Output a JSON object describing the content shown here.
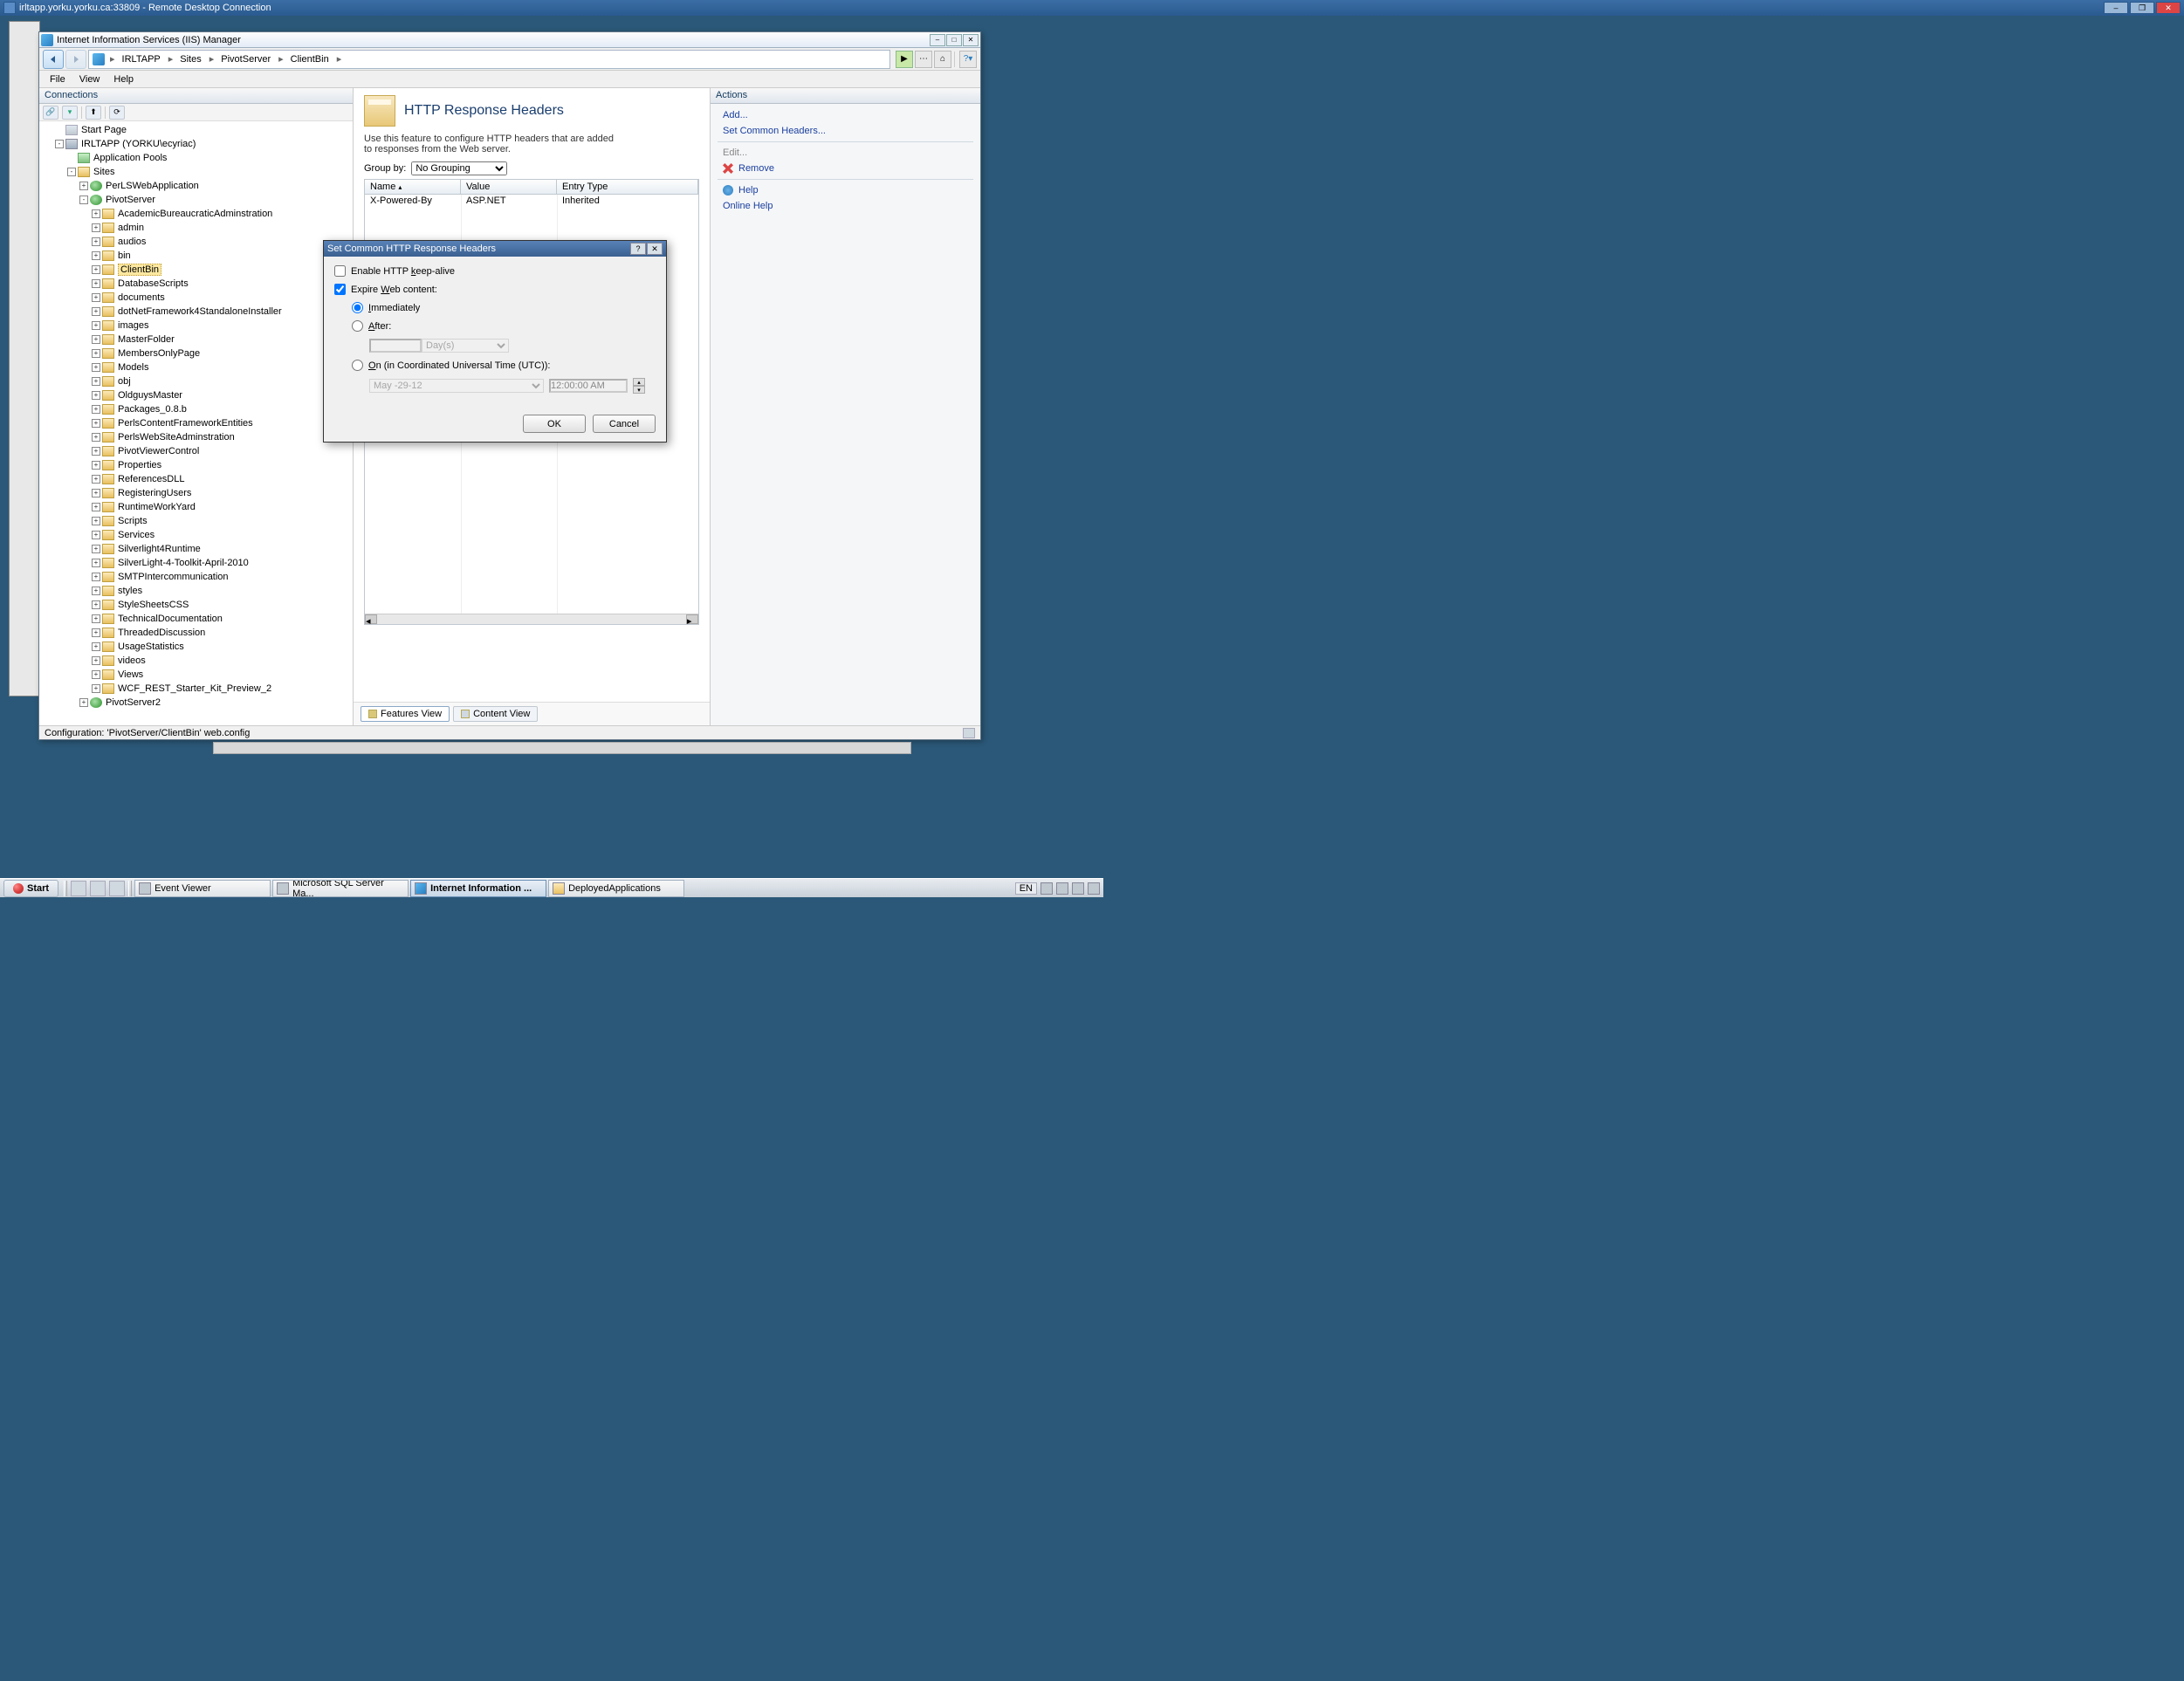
{
  "rdp": {
    "title": "irltapp.yorku.yorku.ca:33809 - Remote Desktop Connection"
  },
  "iis": {
    "title": "Internet Information Services (IIS) Manager",
    "breadcrumb": [
      "IRLTAPP",
      "Sites",
      "PivotServer",
      "ClientBin"
    ],
    "menu": [
      "File",
      "View",
      "Help"
    ],
    "connections_header": "Connections",
    "actions_header": "Actions",
    "status": "Configuration: 'PivotServer/ClientBin' web.config",
    "feature": {
      "title": "HTTP Response Headers",
      "desc": "Use this feature to configure HTTP headers that are added to responses from the Web server.",
      "groupby_label": "Group by:",
      "groupby_value": "No Grouping",
      "columns": [
        "Name",
        "Value",
        "Entry Type"
      ],
      "rows": [
        {
          "name": "X-Powered-By",
          "value": "ASP.NET",
          "entry": "Inherited"
        }
      ],
      "view_tabs": {
        "features": "Features View",
        "content": "Content View"
      }
    },
    "actions": {
      "add": "Add...",
      "set_common": "Set Common Headers...",
      "edit": "Edit...",
      "remove": "Remove",
      "help": "Help",
      "online_help": "Online Help"
    },
    "tree": {
      "start_page": "Start Page",
      "server": "IRLTAPP (YORKU\\ecyriac)",
      "app_pools": "Application Pools",
      "sites": "Sites",
      "perl_app": "PerLSWebApplication",
      "pivot_server": "PivotServer",
      "pivot_children": [
        "AcademicBureaucraticAdminstration",
        "admin",
        "audios",
        "bin",
        "ClientBin",
        "DatabaseScripts",
        "documents",
        "dotNetFramework4StandaloneInstaller",
        "images",
        "MasterFolder",
        "MembersOnlyPage",
        "Models",
        "obj",
        "OldguysMaster",
        "Packages_0.8.b",
        "PerlsContentFrameworkEntities",
        "PerlsWebSiteAdminstration",
        "PivotViewerControl",
        "Properties",
        "ReferencesDLL",
        "RegisteringUsers",
        "RuntimeWorkYard",
        "Scripts",
        "Services",
        "Silverlight4Runtime",
        "SilverLight-4-Toolkit-April-2010",
        "SMTPIntercommunication",
        "styles",
        "StyleSheetsCSS",
        "TechnicalDocumentation",
        "ThreadedDiscussion",
        "UsageStatistics",
        "videos",
        "Views",
        "WCF_REST_Starter_Kit_Preview_2"
      ],
      "pivot_server2": "PivotServer2"
    }
  },
  "dialog": {
    "title": "Set Common HTTP Response Headers",
    "keepalive": "Enable HTTP keep-alive",
    "expire": "Expire Web content:",
    "immediately": "Immediately",
    "after": "After:",
    "after_unit": "Day(s)",
    "on_utc": "On (in Coordinated Universal Time (UTC)):",
    "date_value": "May   -29-12",
    "time_value": "12:00:00 AM",
    "ok": "OK",
    "cancel": "Cancel"
  },
  "taskbar": {
    "start": "Start",
    "items": [
      "Event Viewer",
      "Microsoft SQL Server Ma...",
      "Internet Information ...",
      "DeployedApplications"
    ],
    "lang": "EN"
  }
}
